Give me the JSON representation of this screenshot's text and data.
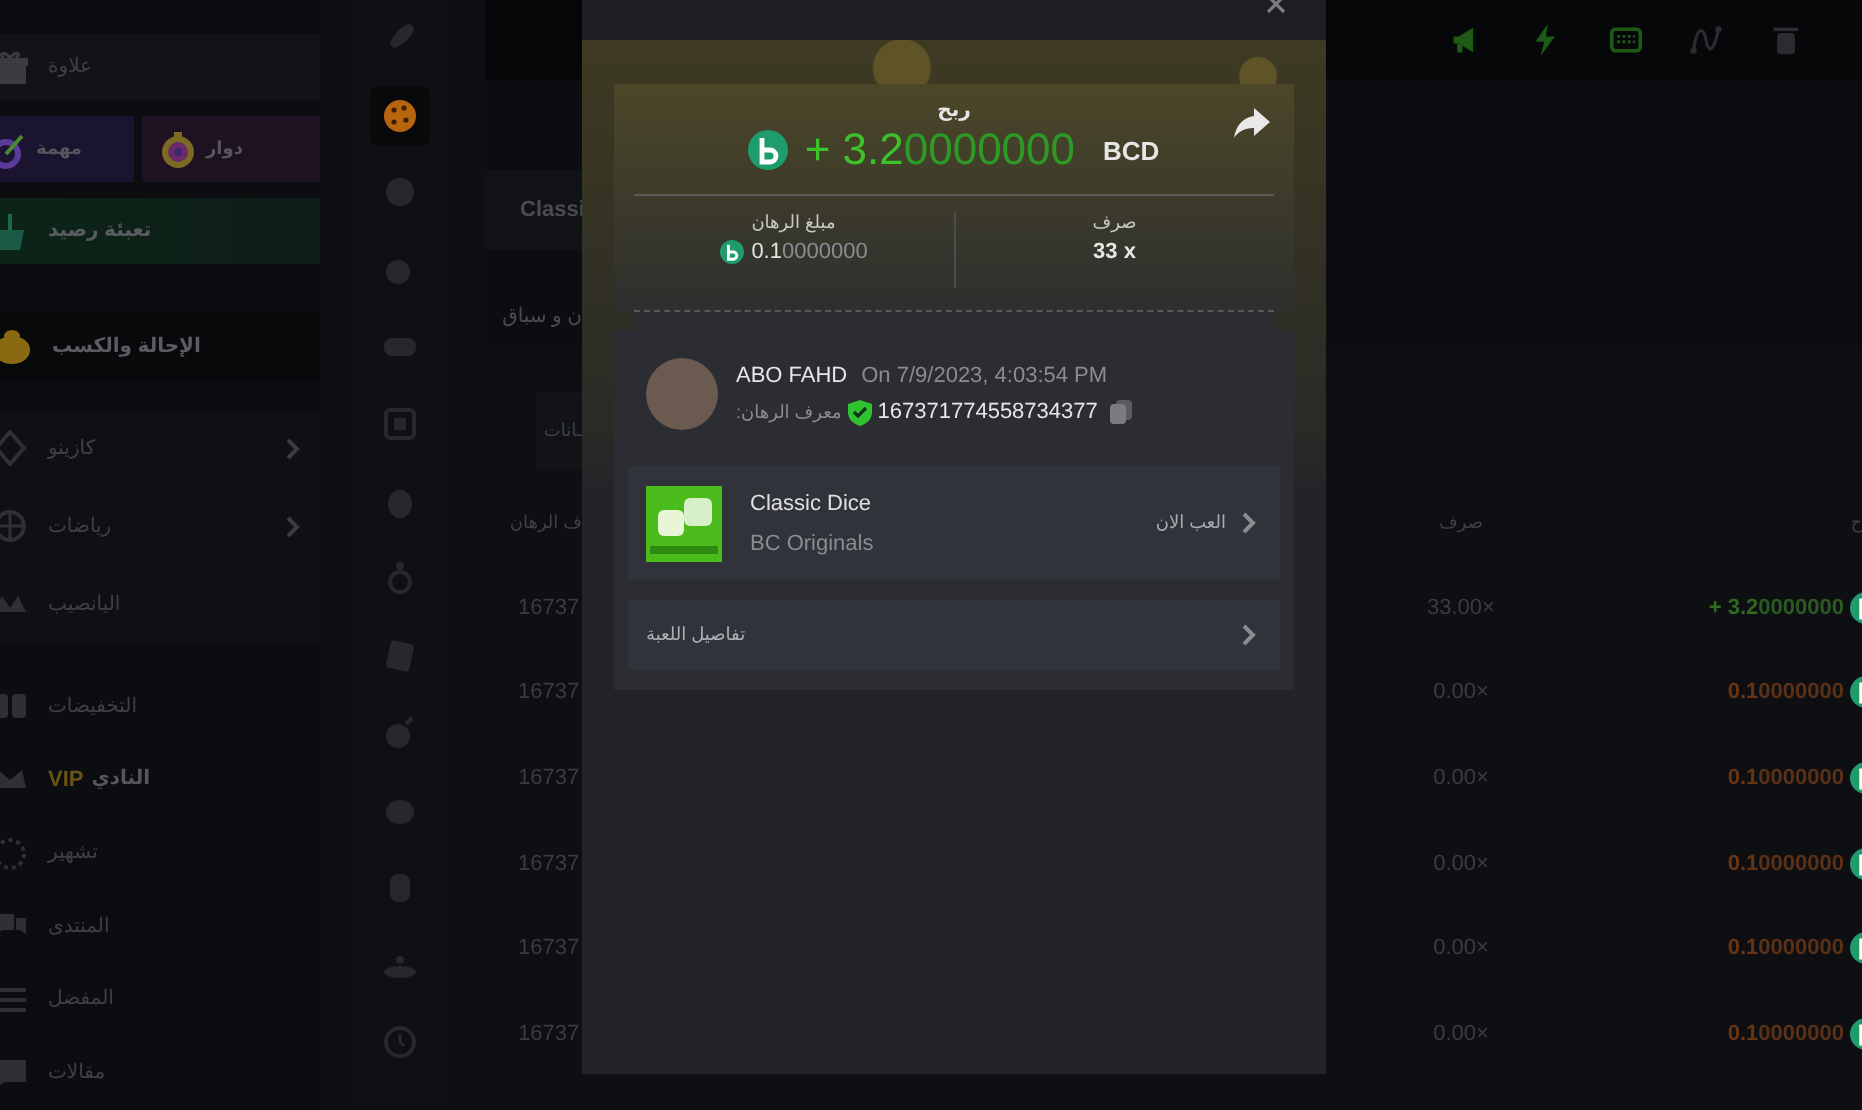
{
  "sidebar": {
    "bonus": "علاوة",
    "promos": [
      {
        "label": "دوار",
        "kind": "spin"
      },
      {
        "label": "مهمة",
        "kind": "quest"
      }
    ],
    "deposit": "تعبئة رصيد",
    "referral": "الإحالة والكسب",
    "menu": [
      {
        "label": "كازينو",
        "expandable": true
      },
      {
        "label": "رياضات",
        "expandable": true
      },
      {
        "label": "اليانصيب",
        "expandable": false
      }
    ],
    "links": [
      {
        "label": "التخفيضات",
        "kind": "discount"
      },
      {
        "label": "النادي",
        "badge": "VIP",
        "kind": "crown"
      },
      {
        "label": "تشهير",
        "kind": "ring"
      },
      {
        "label": "المنتدى",
        "kind": "chat"
      },
      {
        "label": "المفضل",
        "kind": "list"
      },
      {
        "label": "مقالات",
        "kind": "bubble"
      }
    ]
  },
  "game_rail": [
    {
      "selected": false
    },
    {
      "selected": true
    },
    {
      "selected": false
    },
    {
      "selected": false
    },
    {
      "selected": false
    },
    {
      "selected": false
    },
    {
      "selected": false
    },
    {
      "selected": false
    },
    {
      "selected": false
    },
    {
      "selected": false
    },
    {
      "selected": false
    },
    {
      "selected": false
    },
    {
      "selected": false
    },
    {
      "selected": false
    }
  ],
  "toolbar": [
    {
      "kind": "megaphone",
      "on": true
    },
    {
      "kind": "lightning",
      "on": true
    },
    {
      "kind": "keyboard",
      "on": true
    },
    {
      "kind": "curve",
      "on": false
    },
    {
      "kind": "trash",
      "on": false
    }
  ],
  "tab": "Classi",
  "heading": "ن و سباق",
  "subtab": "ـانات",
  "table": {
    "columns": [
      "ح",
      "صرف",
      "ف الرهان"
    ],
    "rows": [
      {
        "bet_id": "16737",
        "payout": "33.00×",
        "amount": {
          "main": "+ 3.2",
          "rest": "0000000"
        },
        "kind": "win"
      },
      {
        "bet_id": "16737",
        "payout": "0.00×",
        "amount": {
          "main": "0.1",
          "rest": "0000000"
        },
        "kind": "loss"
      },
      {
        "bet_id": "16737",
        "payout": "0.00×",
        "amount": {
          "main": "0.1",
          "rest": "0000000"
        },
        "kind": "loss"
      },
      {
        "bet_id": "16737",
        "payout": "0.00×",
        "amount": {
          "main": "0.1",
          "rest": "0000000"
        },
        "kind": "loss"
      },
      {
        "bet_id": "16737",
        "payout": "0.00×",
        "amount": {
          "main": "0.1",
          "rest": "0000000"
        },
        "kind": "loss"
      },
      {
        "bet_id": "16737",
        "payout": "0.00×",
        "amount": {
          "main": "0.1",
          "rest": "0000000"
        },
        "kind": "loss"
      }
    ]
  },
  "modal": {
    "result_label": "ربح",
    "amount": {
      "main": "+ 3.2",
      "rest": "0000000"
    },
    "currency": "BCD",
    "bet_amount_label": "مبلغ الرهان",
    "bet_amount": {
      "main": "0.1",
      "rest": "0000000"
    },
    "payout_label": "صرف",
    "payout": "33 x",
    "player": "ABO FAHD",
    "time": "On 7/9/2023, 4:03:54 PM",
    "bet_id_label": "معرف الرهان:",
    "verified": true,
    "bet_id": "167371774558734377",
    "game": {
      "title": "Classic Dice",
      "provider": "BC Originals",
      "play": "العب الان"
    },
    "details": "تفاصيل اللعبة"
  }
}
